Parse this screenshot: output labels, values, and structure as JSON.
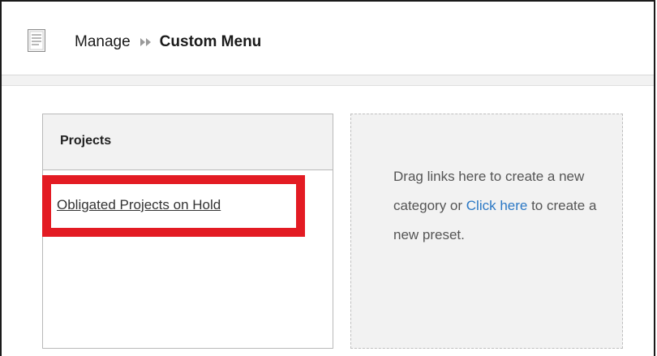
{
  "breadcrumb": {
    "parent": "Manage",
    "current": "Custom Menu"
  },
  "icons": {
    "page": "document-icon",
    "separator": "double-chevron-right-icon"
  },
  "category": {
    "title": "Projects",
    "links": [
      "Obligated Projects on Hold"
    ]
  },
  "drop_zone": {
    "text_before": "Drag links here to create a new category or ",
    "link_label": "Click here",
    "text_after": " to create a new preset."
  },
  "colors": {
    "highlight": "#e31b23",
    "link": "#2b78c5"
  }
}
